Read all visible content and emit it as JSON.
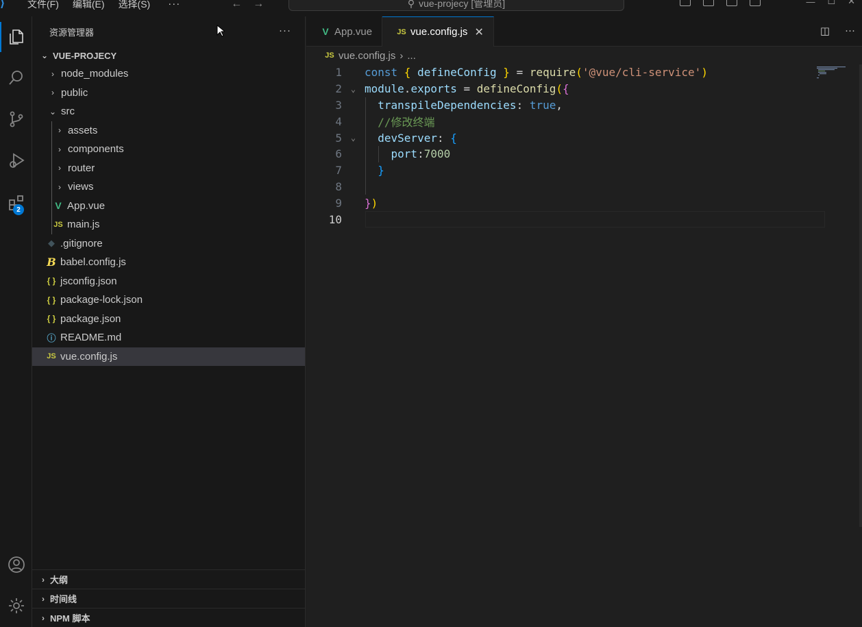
{
  "titlebar": {
    "menu": [
      "文件(F)",
      "编辑(E)",
      "选择(S)"
    ],
    "more": "···",
    "search_text": "vue-projecy [管理员]"
  },
  "activity": {
    "extensions_badge": "2"
  },
  "sidebar": {
    "title": "资源管理器",
    "more": "···",
    "root": "VUE-PROJECY",
    "tree": [
      {
        "label": "node_modules",
        "type": "folder",
        "open": false,
        "depth": 0
      },
      {
        "label": "public",
        "type": "folder",
        "open": false,
        "depth": 0
      },
      {
        "label": "src",
        "type": "folder",
        "open": true,
        "depth": 0
      },
      {
        "label": "assets",
        "type": "folder",
        "open": false,
        "depth": 1
      },
      {
        "label": "components",
        "type": "folder",
        "open": false,
        "depth": 1
      },
      {
        "label": "router",
        "type": "folder",
        "open": false,
        "depth": 1
      },
      {
        "label": "views",
        "type": "folder",
        "open": false,
        "depth": 1
      },
      {
        "label": "App.vue",
        "type": "vue",
        "depth": 1
      },
      {
        "label": "main.js",
        "type": "js",
        "depth": 1
      },
      {
        "label": ".gitignore",
        "type": "git",
        "depth": 0
      },
      {
        "label": "babel.config.js",
        "type": "babel",
        "depth": 0
      },
      {
        "label": "jsconfig.json",
        "type": "json",
        "depth": 0
      },
      {
        "label": "package-lock.json",
        "type": "json",
        "depth": 0
      },
      {
        "label": "package.json",
        "type": "json",
        "depth": 0
      },
      {
        "label": "README.md",
        "type": "info",
        "depth": 0
      },
      {
        "label": "vue.config.js",
        "type": "js",
        "depth": 0,
        "selected": true
      }
    ],
    "panels": [
      "大纲",
      "时间线",
      "NPM 脚本"
    ]
  },
  "editor": {
    "tabs": [
      {
        "label": "App.vue",
        "icon": "vue",
        "active": false
      },
      {
        "label": "vue.config.js",
        "icon": "js",
        "active": true
      }
    ],
    "breadcrumb": {
      "file": "vue.config.js",
      "sep": "›",
      "rest": "..."
    },
    "icons": {
      "js": "JS",
      "vue": "V",
      "json": "{ }",
      "babel": "B",
      "info": "ⓘ",
      "git": "◆"
    },
    "current_line": 10,
    "lines": [
      {
        "n": 1,
        "fold": "",
        "tokens": [
          [
            "k",
            "const "
          ],
          [
            "b1",
            "{ "
          ],
          [
            "v",
            "defineConfig "
          ],
          [
            "b1",
            "}"
          ],
          [
            "p",
            " = "
          ],
          [
            "f",
            "require"
          ],
          [
            "b1",
            "("
          ],
          [
            "s",
            "'@vue/cli-service'"
          ],
          [
            "b1",
            ")"
          ]
        ]
      },
      {
        "n": 2,
        "fold": "⌄",
        "tokens": [
          [
            "v",
            "module"
          ],
          [
            "p",
            "."
          ],
          [
            "v",
            "exports"
          ],
          [
            "p",
            " = "
          ],
          [
            "f",
            "defineConfig"
          ],
          [
            "b1",
            "("
          ],
          [
            "b2",
            "{"
          ]
        ]
      },
      {
        "n": 3,
        "fold": "",
        "tokens": [
          [
            "p",
            "  "
          ],
          [
            "v",
            "transpileDependencies"
          ],
          [
            "p",
            ": "
          ],
          [
            "k",
            "true"
          ],
          [
            "p",
            ","
          ]
        ]
      },
      {
        "n": 4,
        "fold": "",
        "tokens": [
          [
            "p",
            "  "
          ],
          [
            "c",
            "//修改终端"
          ]
        ]
      },
      {
        "n": 5,
        "fold": "⌄",
        "tokens": [
          [
            "p",
            "  "
          ],
          [
            "v",
            "devServer"
          ],
          [
            "p",
            ": "
          ],
          [
            "b3",
            "{"
          ]
        ]
      },
      {
        "n": 6,
        "fold": "",
        "tokens": [
          [
            "p",
            "    "
          ],
          [
            "v",
            "port"
          ],
          [
            "p",
            ":"
          ],
          [
            "n",
            "7000"
          ]
        ]
      },
      {
        "n": 7,
        "fold": "",
        "tokens": [
          [
            "p",
            "  "
          ],
          [
            "b3",
            "}"
          ]
        ]
      },
      {
        "n": 8,
        "fold": "",
        "tokens": []
      },
      {
        "n": 9,
        "fold": "",
        "tokens": [
          [
            "b2",
            "}"
          ],
          [
            "b1",
            ")"
          ]
        ]
      },
      {
        "n": 10,
        "fold": "",
        "tokens": []
      }
    ]
  }
}
